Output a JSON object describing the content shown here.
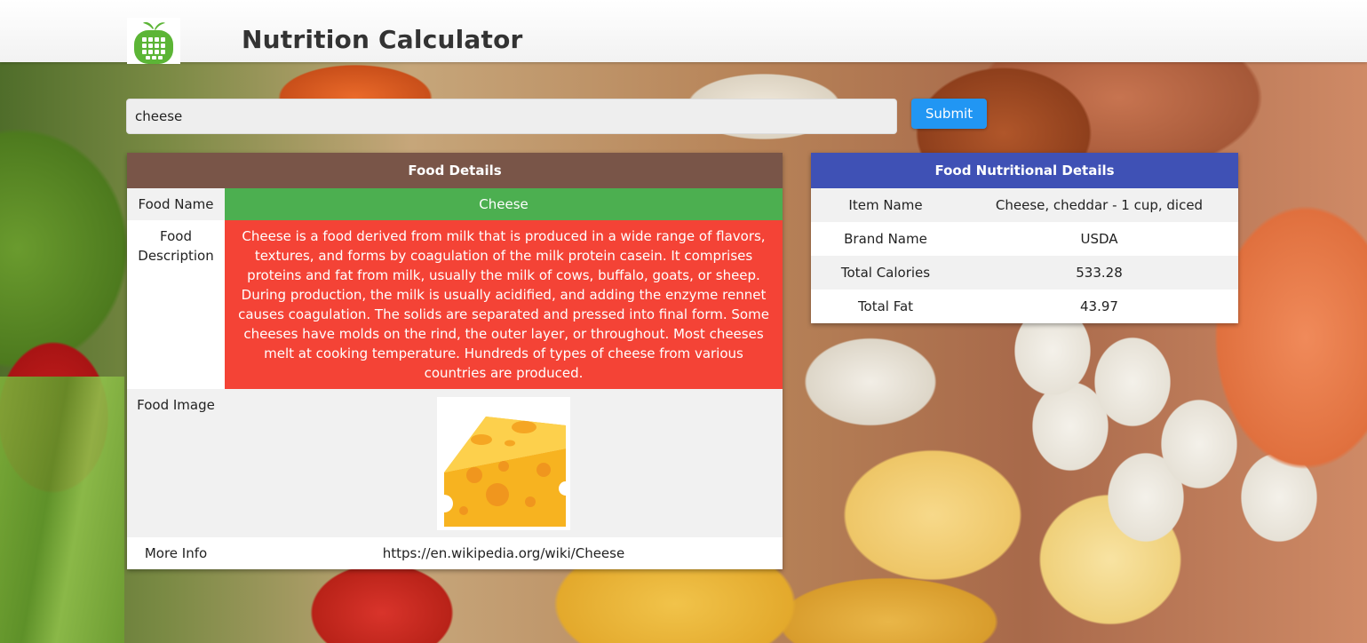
{
  "header": {
    "title": "Nutrition Calculator",
    "logo_icon": "apple-calculator-icon"
  },
  "search": {
    "value": "cheese",
    "submit_label": "Submit"
  },
  "food_details": {
    "heading": "Food Details",
    "rows": {
      "name_label": "Food Name",
      "name_value": "Cheese",
      "description_label": "Food Description",
      "description_value": "Cheese is a food derived from milk that is produced in a wide range of flavors, textures, and forms by coagulation of the milk protein casein. It comprises proteins and fat from milk, usually the milk of cows, buffalo, goats, or sheep. During production, the milk is usually acidified, and adding the enzyme rennet causes coagulation. The solids are separated and pressed into final form. Some cheeses have molds on the rind, the outer layer, or throughout. Most cheeses melt at cooking temperature. Hundreds of types of cheese from various countries are produced.",
      "image_label": "Food Image",
      "image_icon": "cheese-wedge-icon",
      "more_info_label": "More Info",
      "more_info_value": "https://en.wikipedia.org/wiki/Cheese"
    }
  },
  "nutrition_details": {
    "heading": "Food Nutritional Details",
    "rows": [
      {
        "label": "Item Name",
        "value": "Cheese, cheddar - 1 cup, diced"
      },
      {
        "label": "Brand Name",
        "value": "USDA"
      },
      {
        "label": "Total Calories",
        "value": "533.28"
      },
      {
        "label": "Total Fat",
        "value": "43.97"
      }
    ]
  },
  "colors": {
    "header_bg": "#ffffff",
    "food_heading_bg": "#795548",
    "nutrition_heading_bg": "#3f51b5",
    "name_cell_bg": "#4caf50",
    "description_cell_bg": "#f44336",
    "submit_bg": "#2196f3",
    "logo_green": "#5cb536"
  }
}
